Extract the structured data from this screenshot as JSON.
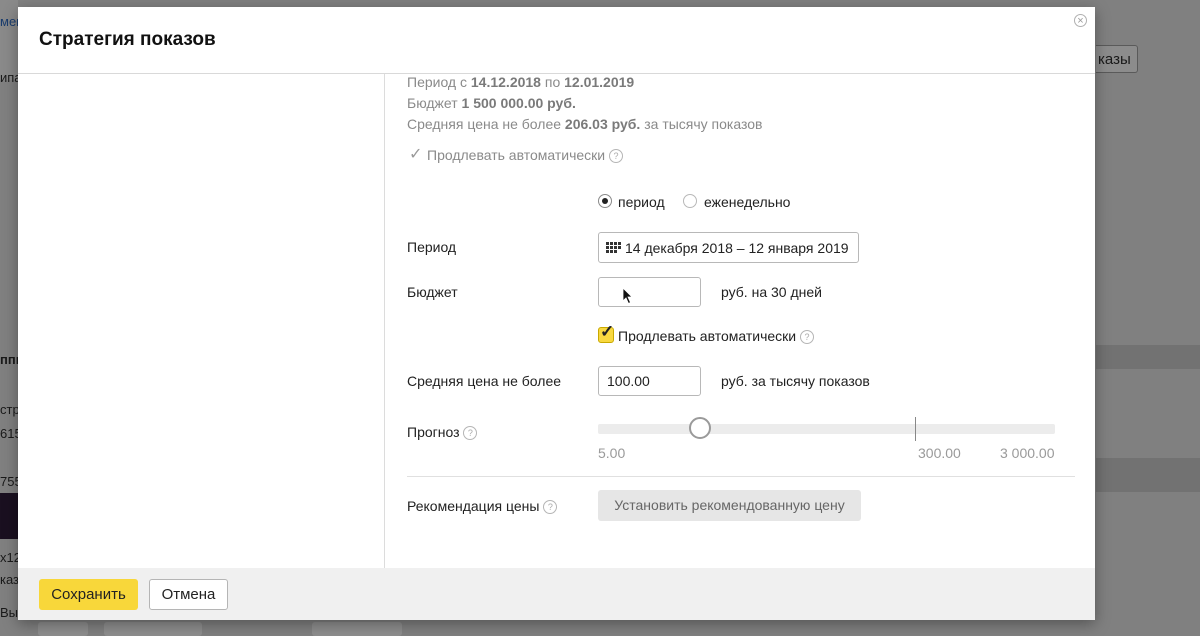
{
  "background": {
    "fragments": [
      "мен",
      "ипа",
      "ппи",
      "стр",
      "615",
      "755",
      "x12",
      "каз",
      "Выб"
    ],
    "button_label": "казы"
  },
  "modal": {
    "title": "Стратегия показов",
    "close_label": "×",
    "summary": {
      "period_prefix": "Период с",
      "period_from": "14.12.2018",
      "period_mid": "по",
      "period_to": "12.01.2019",
      "budget_prefix": "Бюджет",
      "budget_value": "1 500 000.00 руб.",
      "avg_prefix": "Средняя цена не более",
      "avg_value": "206.03 руб.",
      "avg_suffix": "за тысячу показов",
      "auto_renew_label": "Продлевать автоматически",
      "auto_renew_checked": true
    },
    "schedule": {
      "options": [
        "период",
        "еженедельно"
      ],
      "selected": "период"
    },
    "period": {
      "label": "Период",
      "value": "14 декабря 2018 – 12 января 2019"
    },
    "budget": {
      "label": "Бюджет",
      "value": "",
      "suffix": "руб. на 30 дней"
    },
    "auto_renew": {
      "label": "Продлевать автоматически",
      "checked": true
    },
    "avg_price": {
      "label": "Средняя цена не более",
      "value": "100.00",
      "suffix": "руб. за тысячу показов"
    },
    "forecast": {
      "label": "Прогноз",
      "min_label": "5.00",
      "mark_label": "300.00",
      "max_label": "3 000.00"
    },
    "recommendation": {
      "label": "Рекомендация цены",
      "button_label": "Установить рекомендованную цену"
    },
    "footer": {
      "save_label": "Сохранить",
      "cancel_label": "Отмена"
    },
    "help_glyph": "?",
    "check_glyph": "✓"
  },
  "colors": {
    "accent_yellow": "#f8d73a",
    "overlay": "#808080"
  }
}
